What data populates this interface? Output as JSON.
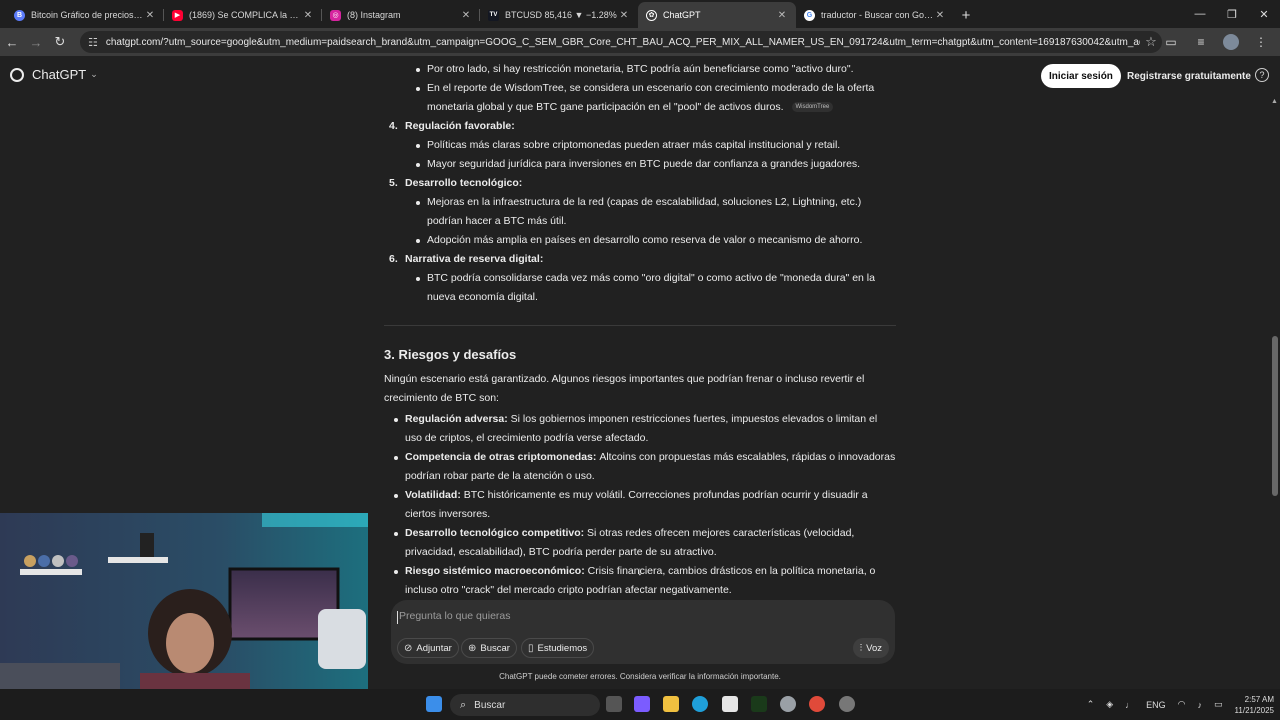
{
  "browser": {
    "tabs": [
      {
        "title": "Bitcoin Gráfico de precios (BTC)",
        "icon": "coin-icon",
        "color": "#5c7cfa",
        "glyph": "B"
      },
      {
        "title": "(1869) Se COMPLICA la Caída",
        "icon": "youtube-icon",
        "color": "#ff0033",
        "glyph": "▶"
      },
      {
        "title": "(8) Instagram",
        "icon": "instagram-icon",
        "color": "#d6249f",
        "glyph": "◎"
      },
      {
        "title": "BTCUSD 85,416 ▼ −1.28%",
        "icon": "tradingview-icon",
        "color": "#131722",
        "glyph": "TV"
      },
      {
        "title": "ChatGPT",
        "icon": "chatgpt-icon",
        "color": "#444444",
        "glyph": "✿"
      },
      {
        "title": "traductor - Buscar con Google",
        "icon": "google-icon",
        "color": "#4285f4",
        "glyph": "G"
      }
    ],
    "url": "chatgpt.com/?utm_source=google&utm_medium=paidsearch_brand&utm_campaign=GOOG_C_SEM_GBR_Core_CHT_BAU_ACQ_PER_MIX_ALL_NAMER_US_EN_091724&utm_term=chatgpt&utm_content=169187630042&utm_ad=713941893298&utm_ad..."
  },
  "header": {
    "brand": "ChatGPT",
    "login_label": "Iniciar sesión",
    "signup_label": "Registrarse gratuitamente",
    "help_glyph": "?"
  },
  "content": {
    "top_bullets": [
      "Por otro lado, si hay restricción monetaria, BTC podría aún beneficiarse como \"activo duro\".",
      "En el reporte de WisdomTree, se considera un escenario con crecimiento moderado de la oferta monetaria global y que BTC gane participación en el \"pool\" de activos duros."
    ],
    "source_badge": "WisdomTree",
    "sections": [
      {
        "number": "4.",
        "title": "Regulación favorable",
        "bullets": [
          "Políticas más claras sobre criptomonedas pueden atraer más capital institucional y retail.",
          "Mayor seguridad jurídica para inversiones en BTC puede dar confianza a grandes jugadores."
        ]
      },
      {
        "number": "5.",
        "title": "Desarrollo tecnológico",
        "bullets": [
          "Mejoras en la infraestructura de la red (capas de escalabilidad, soluciones L2, Lightning, etc.) podrían hacer a BTC más útil.",
          "Adopción más amplia en países en desarrollo como reserva de valor o mecanismo de ahorro."
        ]
      },
      {
        "number": "6.",
        "title": "Narrativa de reserva digital",
        "bullets": [
          "BTC podría consolidarse cada vez más como \"oro digital\" o como activo de \"moneda dura\" en la nueva economía digital."
        ]
      }
    ],
    "risks_heading": "3. Riesgos y desafíos",
    "risks_intro": "Ningún escenario está garantizado. Algunos riesgos importantes que podrían frenar o incluso revertir el crecimiento de BTC son:",
    "risks": [
      {
        "term": "Regulación adversa",
        "text": "Si los gobiernos imponen restricciones fuertes, impuestos elevados o limitan el uso de criptos, el crecimiento podría verse afectado."
      },
      {
        "term": "Competencia de otras criptomonedas",
        "text": "Altcoins con propuestas más escalables, rápidas o innovadoras podrían robar parte de la atención o uso."
      },
      {
        "term": "Volatilidad",
        "text": "BTC históricamente es muy volátil. Correcciones profundas podrían ocurrir y disuadir a ciertos inversores."
      },
      {
        "term": "Desarrollo tecnológico competitivo",
        "text": "Si otras redes ofrecen mejores características (velocidad, privacidad, escalabilidad), BTC podría perder parte de su atractivo."
      },
      {
        "term": "Riesgo sistémico macroeconómico",
        "text": "Crisis financiera, cambios drásticos en la política monetaria, o incluso otro \"crack\" del mercado cripto podrían afectar negativamente."
      }
    ]
  },
  "composer": {
    "placeholder": "Pregunta lo que quieras",
    "attach_label": "Adjuntar",
    "search_label": "Buscar",
    "study_label": "Estudiemos",
    "voice_label": "Voz"
  },
  "disclaimer": "ChatGPT puede cometer errores. Considera verificar la información importante.",
  "taskbar": {
    "search_label": "Buscar",
    "lang": "ENG",
    "time": "2:57 AM",
    "date": "11/21/2025"
  }
}
